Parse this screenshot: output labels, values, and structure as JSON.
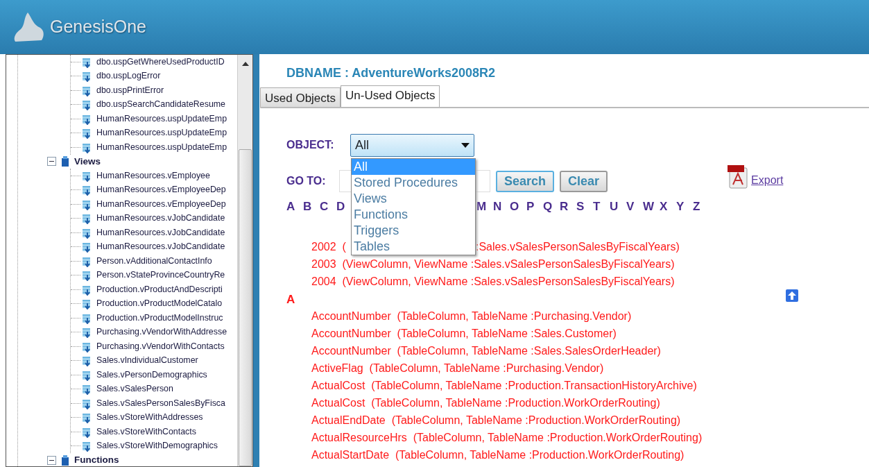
{
  "header": {
    "title": "GenesisOne"
  },
  "tree": {
    "orphans": [
      {
        "label": "dbo.uspGetWhereUsedProductID"
      },
      {
        "label": "dbo.uspLogError"
      },
      {
        "label": "dbo.uspPrintError"
      },
      {
        "label": "dbo.uspSearchCandidateResume"
      },
      {
        "label": "HumanResources.uspUpdateEmp"
      },
      {
        "label": "HumanResources.uspUpdateEmp"
      },
      {
        "label": "HumanResources.uspUpdateEmp"
      }
    ],
    "folders": [
      {
        "label": "Views",
        "expanded": true,
        "children": [
          {
            "label": "HumanResources.vEmployee"
          },
          {
            "label": "HumanResources.vEmployeeDep"
          },
          {
            "label": "HumanResources.vEmployeeDep"
          },
          {
            "label": "HumanResources.vJobCandidate"
          },
          {
            "label": "HumanResources.vJobCandidate"
          },
          {
            "label": "HumanResources.vJobCandidate"
          },
          {
            "label": "Person.vAdditionalContactInfo"
          },
          {
            "label": "Person.vStateProvinceCountryRe"
          },
          {
            "label": "Production.vProductAndDescripti"
          },
          {
            "label": "Production.vProductModelCatalo"
          },
          {
            "label": "Production.vProductModelInstruc"
          },
          {
            "label": "Purchasing.vVendorWithAddresse"
          },
          {
            "label": "Purchasing.vVendorWithContacts"
          },
          {
            "label": "Sales.vIndividualCustomer"
          },
          {
            "label": "Sales.vPersonDemographics"
          },
          {
            "label": "Sales.vSalesPerson"
          },
          {
            "label": "Sales.vSalesPersonSalesByFisca"
          },
          {
            "label": "Sales.vStoreWithAddresses"
          },
          {
            "label": "Sales.vStoreWithContacts"
          },
          {
            "label": "Sales.vStoreWithDemographics"
          }
        ]
      },
      {
        "label": "Functions",
        "expanded": true
      }
    ]
  },
  "db_title": "DBNAME : AdventureWorks2008R2",
  "tabs": [
    {
      "label": "Used Objects",
      "selected": false
    },
    {
      "label": "Un-Used Objects",
      "selected": true
    }
  ],
  "object_label": "OBJECT:",
  "object_select": {
    "value": "All",
    "open": true,
    "options": [
      {
        "label": "All",
        "selected": true
      },
      {
        "label": "Stored Procedures",
        "selected": false
      },
      {
        "label": "Views",
        "selected": false
      },
      {
        "label": "Functions",
        "selected": false
      },
      {
        "label": "Triggers",
        "selected": false
      },
      {
        "label": "Tables",
        "selected": false
      }
    ]
  },
  "goto_label": "GO TO:",
  "buttons": [
    "Search",
    "Clear"
  ],
  "export": "Export",
  "letters_left": [
    "A",
    "B",
    "C",
    "D"
  ],
  "letters_right": [
    "M",
    "N",
    "O",
    "P",
    "Q",
    "R",
    "S",
    "T",
    "U",
    "V",
    "W",
    "X",
    "Y",
    "Z"
  ],
  "results": [
    {
      "kind": "split",
      "left": "2002  (",
      "right": ":Sales.vSalesPersonSalesByFiscalYears)"
    },
    {
      "kind": "item",
      "text": "2003  (ViewColumn, ViewName :Sales.vSalesPersonSalesByFiscalYears)"
    },
    {
      "kind": "item",
      "text": "2004  (ViewColumn, ViewName :Sales.vSalesPersonSalesByFiscalYears)"
    },
    {
      "kind": "heading",
      "text": "A"
    },
    {
      "kind": "item",
      "text": "AccountNumber  (TableColumn, TableName :Purchasing.Vendor)"
    },
    {
      "kind": "item",
      "text": "AccountNumber  (TableColumn, TableName :Sales.Customer)"
    },
    {
      "kind": "item",
      "text": "AccountNumber  (TableColumn, TableName :Sales.SalesOrderHeader)"
    },
    {
      "kind": "item",
      "text": "ActiveFlag  (TableColumn, TableName :Purchasing.Vendor)"
    },
    {
      "kind": "item",
      "text": "ActualCost  (TableColumn, TableName :Production.TransactionHistoryArchive)"
    },
    {
      "kind": "item",
      "text": "ActualCost  (TableColumn, TableName :Production.WorkOrderRouting)"
    },
    {
      "kind": "item",
      "text": "ActualEndDate  (TableColumn, TableName :Production.WorkOrderRouting)"
    },
    {
      "kind": "item",
      "text": "ActualResourceHrs  (TableColumn, TableName :Production.WorkOrderRouting)"
    },
    {
      "kind": "item",
      "text": "ActualStartDate  (TableColumn, TableName :Production.WorkOrderRouting)"
    }
  ]
}
